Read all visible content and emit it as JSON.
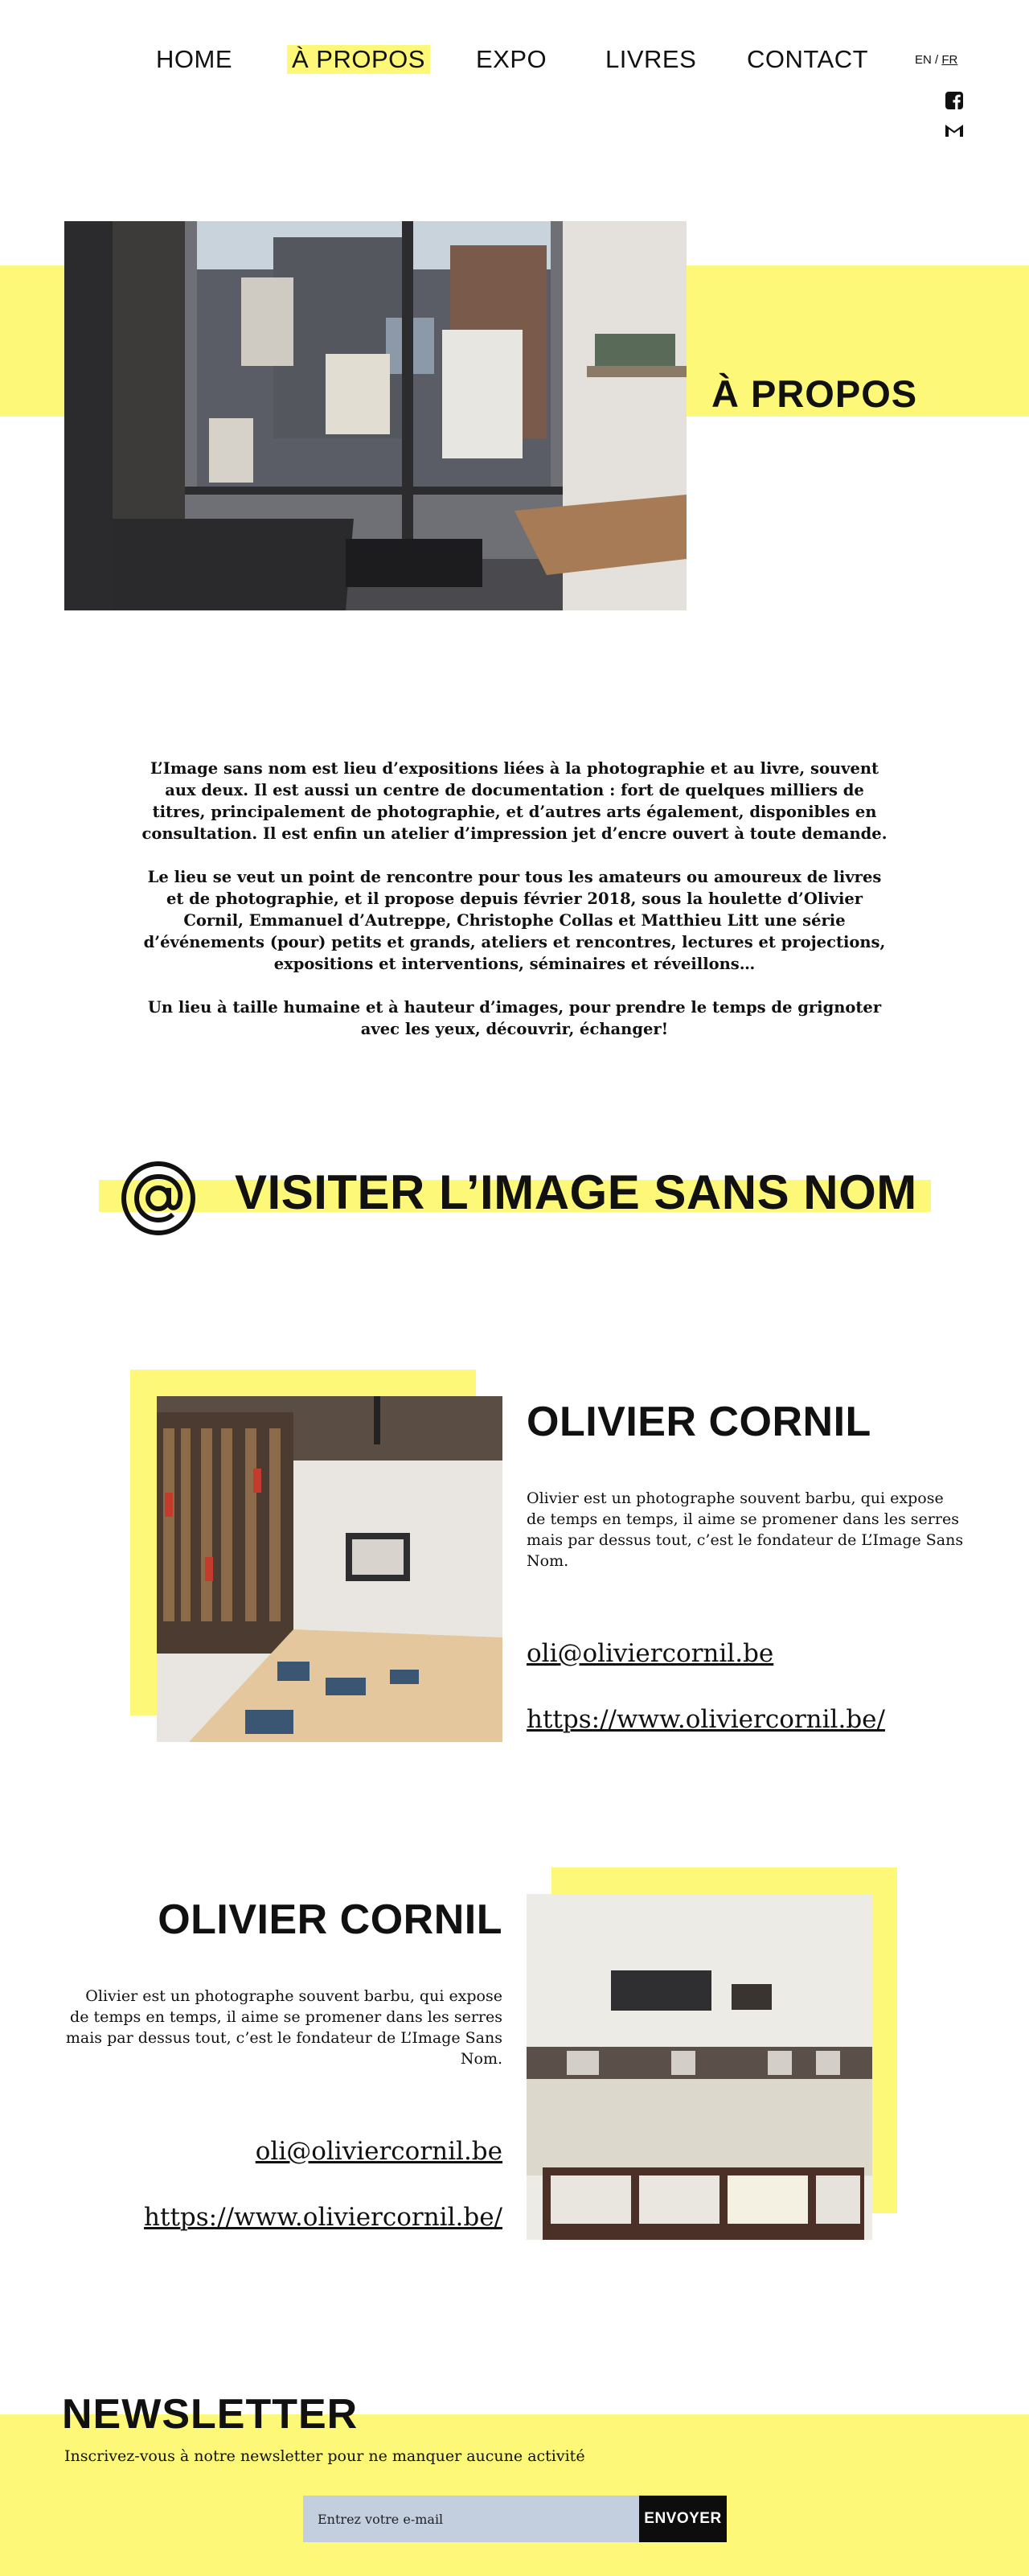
{
  "nav": {
    "items": [
      {
        "label": "HOME"
      },
      {
        "label": "À PROPOS",
        "active": true
      },
      {
        "label": "EXPO"
      },
      {
        "label": "LIVRES"
      },
      {
        "label": "CONTACT"
      }
    ],
    "lang": {
      "en": "EN",
      "separator": " / ",
      "fr": "FR",
      "current": "FR"
    },
    "social": [
      {
        "icon": "facebook-icon"
      },
      {
        "icon": "gmail-icon"
      }
    ]
  },
  "hero": {
    "title": "À PROPOS"
  },
  "intro": {
    "paragraphs": [
      "L’Image sans nom est lieu d’expositions liées à la photographie et au livre, souvent aux deux. Il est aussi un centre de documentation : fort de quelques milliers de titres, principalement de photographie, et d’autres arts également, disponibles en consultation. Il est enfin un atelier d’impression jet d’encre ouvert à toute demande.",
      "Le lieu se veut un point de rencontre pour tous les amateurs ou amoureux de livres et de photographie, et il propose depuis février 2018, sous la houlette d’Olivier Cornil, Emmanuel d’Autreppe, Christophe Collas et Matthieu Litt une série d’événements (pour) petits et grands, ateliers et rencontres, lectures et projections, expositions et interventions, séminaires et réveillons…",
      "Un lieu à taille humaine et à hauteur d’images, pour prendre le temps de grignoter avec les yeux, découvrir, échanger!"
    ]
  },
  "visit": {
    "title": "VISITER L’IMAGE SANS NOM",
    "icon": "at-sign-icon"
  },
  "people": [
    {
      "name": "OLIVIER CORNIL",
      "description": "Olivier est un photographe souvent barbu, qui expose de temps en temps, il aime se promener dans les serres mais par dessus tout, c’est le fondateur de L’Image Sans Nom.",
      "email": "oli@oliviercornil.be",
      "website": "https://www.oliviercornil.be/"
    },
    {
      "name": "OLIVIER CORNIL",
      "description": "Olivier est un photographe souvent barbu, qui expose de temps en temps, il aime se promener dans les serres mais par dessus tout, c’est le fondateur de L’Image Sans Nom.",
      "email": "oli@oliviercornil.be",
      "website": "https://www.oliviercornil.be/"
    }
  ],
  "newsletter": {
    "title": "NEWSLETTER",
    "subtitle": "Inscrivez-vous à notre newsletter pour ne manquer aucune activité",
    "placeholder": "Entrez votre e-mail",
    "button": "ENVOYER"
  },
  "colors": {
    "accent_yellow": "#fdf877",
    "input_blue": "#c3cedf",
    "text": "#111111"
  }
}
